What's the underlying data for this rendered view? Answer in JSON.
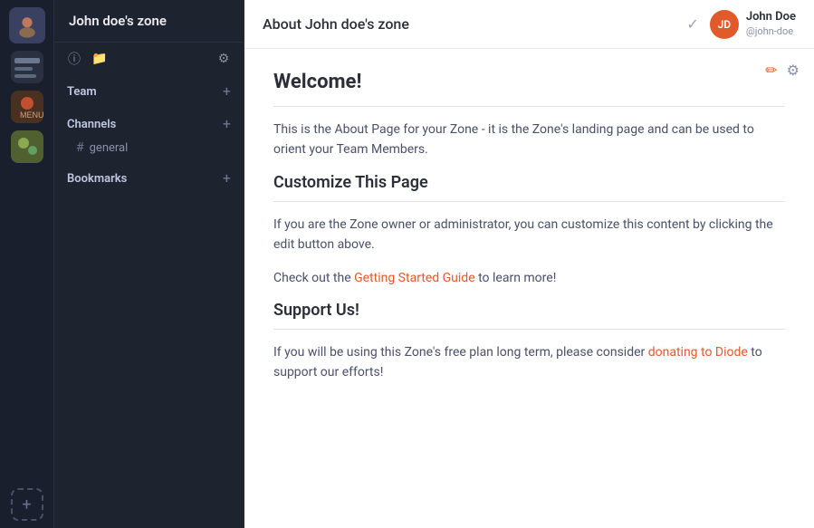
{
  "iconBar": {
    "addLabel": "+"
  },
  "sidebar": {
    "zoneName": "John doe's zone",
    "team": {
      "label": "Team",
      "addLabel": "+"
    },
    "channels": {
      "label": "Channels",
      "addLabel": "+",
      "items": [
        {
          "name": "general",
          "prefix": "#"
        }
      ]
    },
    "bookmarks": {
      "label": "Bookmarks",
      "addLabel": "+"
    }
  },
  "header": {
    "title": "About John doe's zone",
    "user": {
      "initials": "JD",
      "name": "John Doe",
      "handle": "@john-doe"
    }
  },
  "main": {
    "welcome": {
      "heading": "Welcome!",
      "body": "This is the About Page for your Zone - it is the Zone's landing page and can be used to orient your Team Members."
    },
    "customize": {
      "heading": "Customize This Page",
      "body": "If you are the Zone owner or administrator, you can customize this content by clicking the edit button above.",
      "checkoutText": "Check out the ",
      "linkText": "Getting Started Guide",
      "linkSuffix": " to learn more!"
    },
    "support": {
      "heading": "Support Us!",
      "bodyPrefix": "If you will be using this Zone's free plan long term, please consider ",
      "linkText": "donating to Diode",
      "bodySuffix": " to support our efforts!"
    }
  }
}
